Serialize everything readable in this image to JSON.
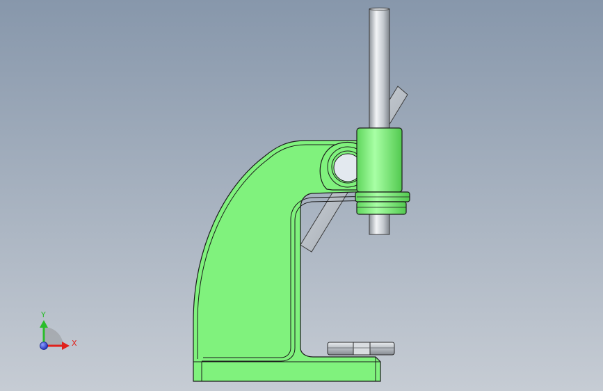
{
  "viewport": {
    "background_top": "#8797ab",
    "background_bottom": "#c6ccd4"
  },
  "model": {
    "body_color": "#80f27d",
    "edge_color": "#1a1a1a",
    "steel_color": "#c9ced4"
  },
  "triad": {
    "x_label": "X",
    "y_label": "Y",
    "x_color": "#e0211c",
    "y_color": "#2bbd2b",
    "z_color": "#2b3bd6"
  }
}
